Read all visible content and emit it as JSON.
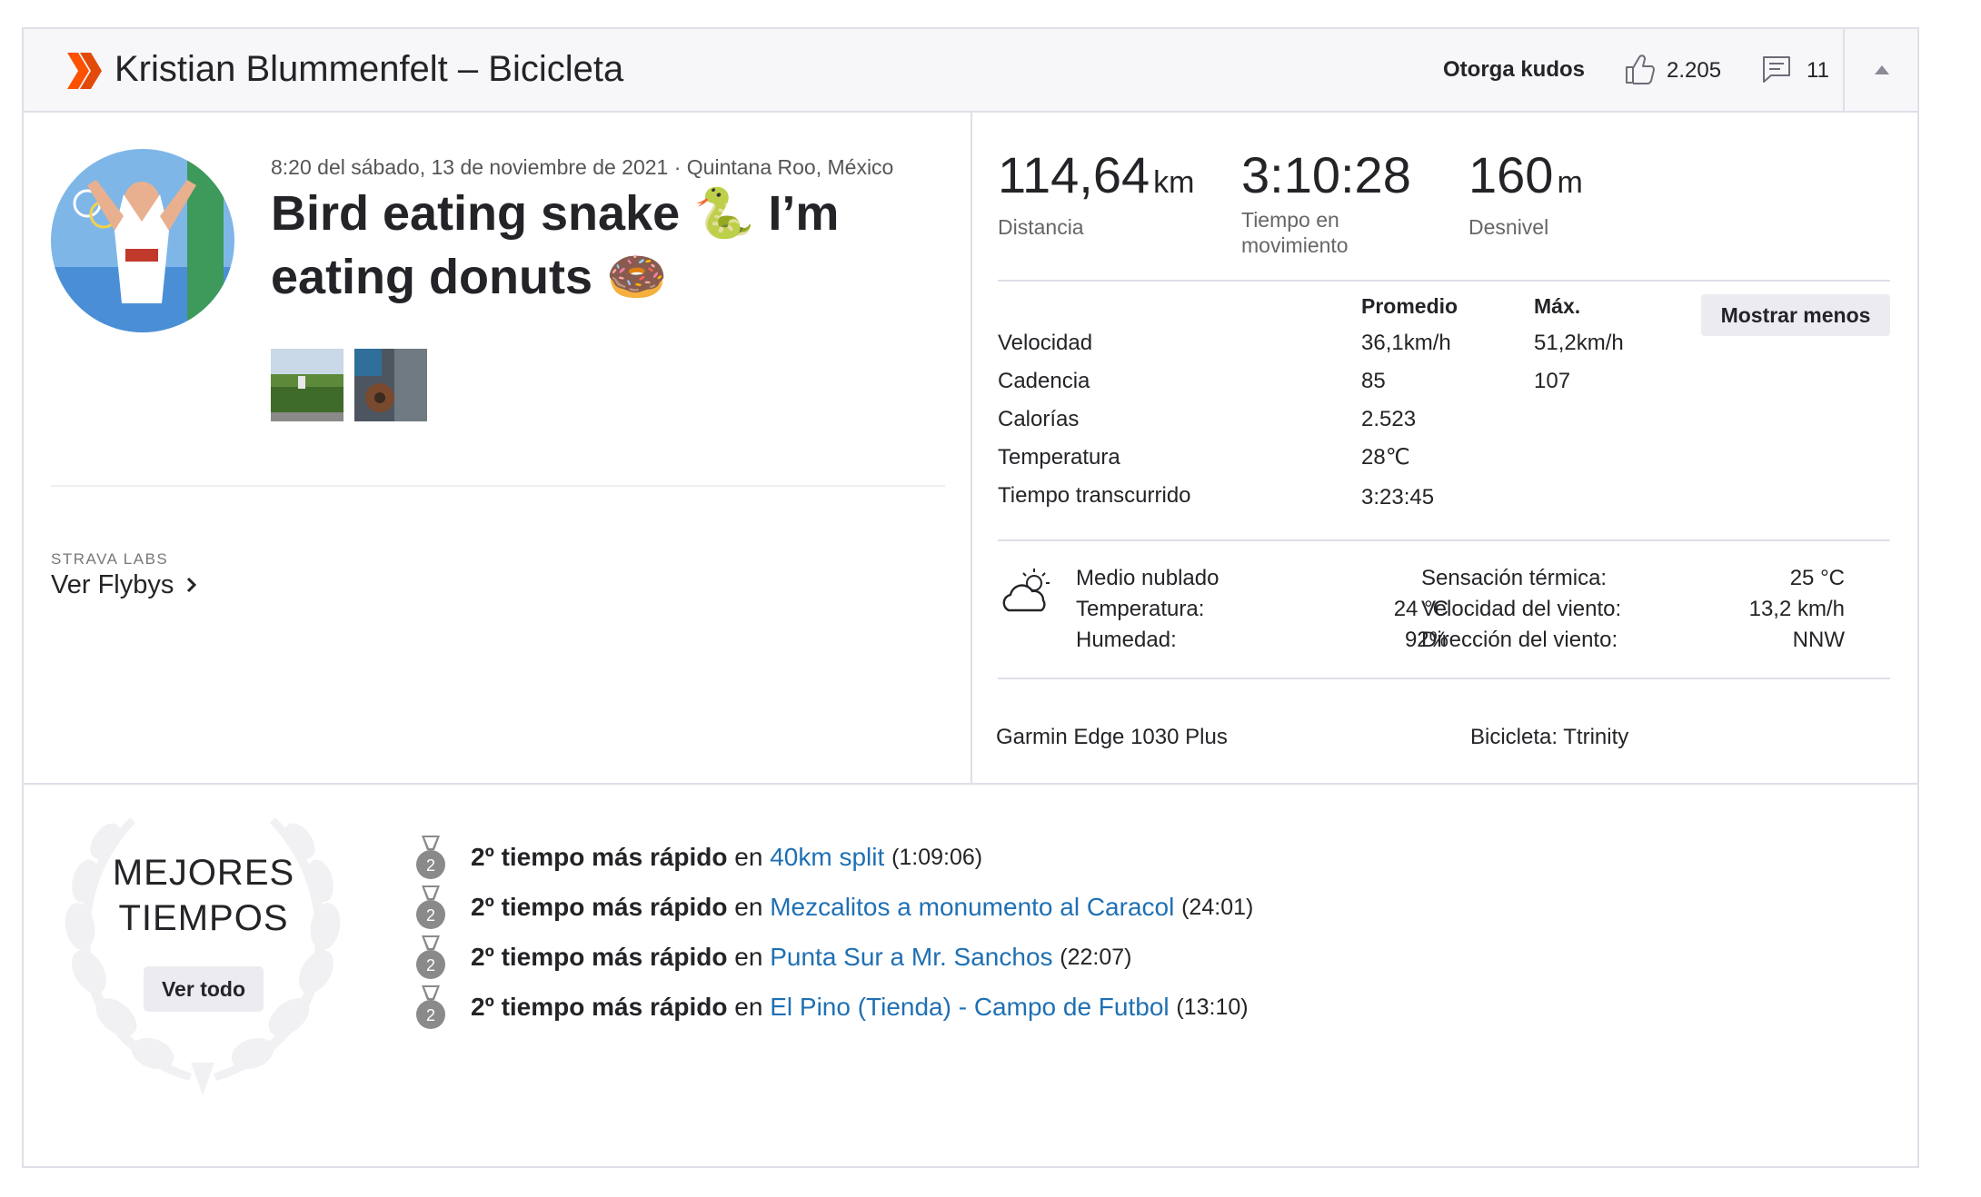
{
  "header": {
    "title": "Kristian Blummenfelt – Bicicleta",
    "kudos_label": "Otorga kudos",
    "kudos_count": "2.205",
    "comment_count": "11"
  },
  "activity": {
    "meta": "8:20 del sábado, 13 de noviembre de 2021 · Quintana Roo, México",
    "title_line1": "Bird eating snake 🐍 I’m",
    "title_line2": "eating donuts 🍩"
  },
  "labs": {
    "label": "STRAVA LABS",
    "link": "Ver Flybys"
  },
  "stats": {
    "distance": {
      "value": "114,64",
      "unit": "km",
      "label": "Distancia"
    },
    "moving_time": {
      "value": "3:10:28",
      "label_line1": "Tiempo en",
      "label_line2": "movimiento"
    },
    "elevation": {
      "value": "160",
      "unit": "m",
      "label": "Desnivel"
    }
  },
  "table": {
    "col_avg": "Promedio",
    "col_max": "Máx.",
    "toggle_label": "Mostrar menos",
    "rows": [
      {
        "label": "Velocidad",
        "avg": "36,1km/h",
        "max": "51,2km/h"
      },
      {
        "label": "Cadencia",
        "avg": "85",
        "max": "107"
      },
      {
        "label": "Calorías",
        "avg": "2.523",
        "max": ""
      },
      {
        "label": "Temperatura",
        "avg": "28℃",
        "max": ""
      },
      {
        "label": "Tiempo transcurrido",
        "avg": "3:23:45",
        "max": ""
      }
    ]
  },
  "weather": {
    "condition": "Medio nublado",
    "temp_label": "Temperatura:",
    "temp_value": "24 °C",
    "humidity_label": "Humedad:",
    "humidity_value": "92%",
    "feels_label": "Sensación térmica:",
    "feels_value": "25 °C",
    "wind_speed_label": "Velocidad del viento:",
    "wind_speed_value": "13,2 km/h",
    "wind_dir_label": "Dirección del viento:",
    "wind_dir_value": "NNW"
  },
  "gear": {
    "device": "Garmin Edge 1030 Plus",
    "bike": "Bicicleta: Ttrinity"
  },
  "best_efforts": {
    "title_line1": "MEJORES",
    "title_line2": "TIEMPOS",
    "view_all": "Ver todo",
    "items": [
      {
        "rank": "2",
        "prefix": "2º tiempo más rápido",
        "connector": "en",
        "segment": "40km split",
        "time": "(1:09:06)"
      },
      {
        "rank": "2",
        "prefix": "2º tiempo más rápido",
        "connector": "en",
        "segment": "Mezcalitos a monumento al Caracol",
        "time": "(24:01)"
      },
      {
        "rank": "2",
        "prefix": "2º tiempo más rápido",
        "connector": "en",
        "segment": "Punta Sur a Mr. Sanchos",
        "time": "(22:07)"
      },
      {
        "rank": "2",
        "prefix": "2º tiempo más rápido",
        "connector": "en",
        "segment": "El Pino (Tienda) - Campo de Futbol",
        "time": "(13:10)"
      }
    ]
  },
  "colors": {
    "brand": "#fc5200",
    "link": "#1f70b3",
    "border": "#dfdfe8",
    "medal": "#8a8a8a"
  }
}
